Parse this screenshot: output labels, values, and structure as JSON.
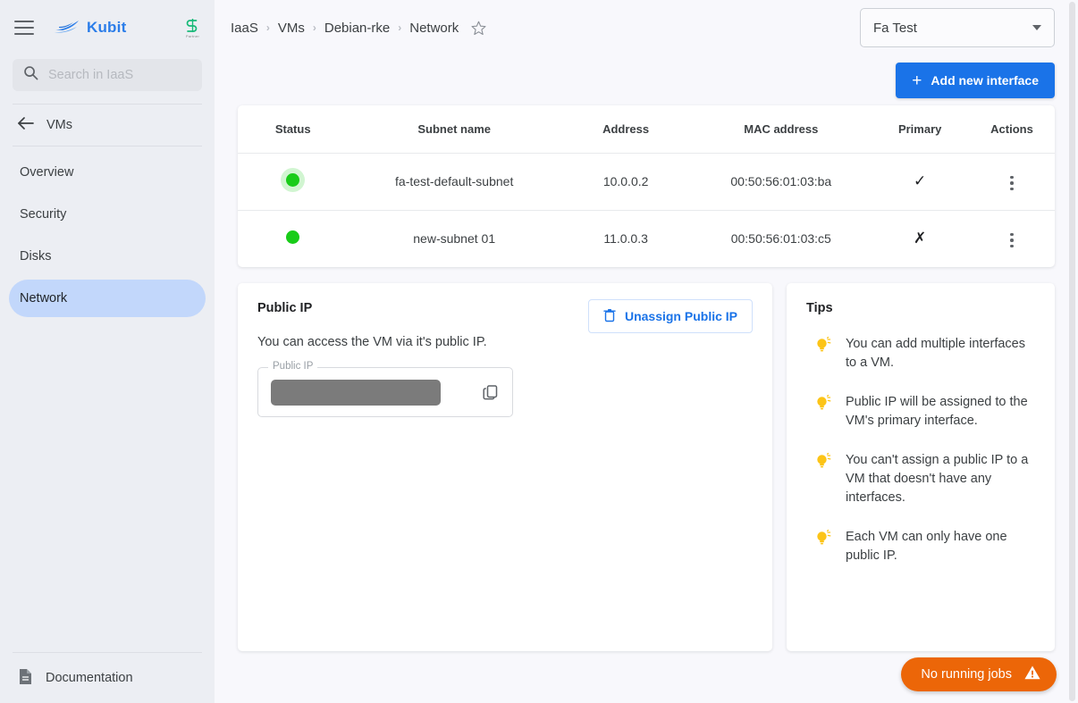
{
  "sidebar": {
    "menu_icon": "hamburger-icon",
    "brand": "Kubit",
    "brand_logo": "boat-logo",
    "partner_logo": "partner-s-logo",
    "partner_sub": "Partner",
    "search": {
      "placeholder": "Search in IaaS",
      "value": ""
    },
    "back": {
      "label": "VMs",
      "icon": "arrow-left-icon"
    },
    "items": [
      {
        "label": "Overview",
        "active": false
      },
      {
        "label": "Security",
        "active": false
      },
      {
        "label": "Disks",
        "active": false
      },
      {
        "label": "Network",
        "active": true
      }
    ],
    "documentation": {
      "label": "Documentation",
      "icon": "document-icon"
    }
  },
  "header": {
    "breadcrumbs": [
      "IaaS",
      "VMs",
      "Debian-rke",
      "Network"
    ],
    "separator": "›",
    "favorite_icon": "star-outline-icon",
    "project_select": {
      "value": "Fa Test",
      "caret": "chevron-down-icon"
    }
  },
  "toolbar": {
    "add_interface_label": "Add new interface",
    "add_interface_icon": "plus-icon"
  },
  "table": {
    "columns": [
      "Status",
      "Subnet name",
      "Address",
      "MAC address",
      "Primary",
      "Actions"
    ],
    "rows": [
      {
        "status": "online",
        "subnet_name": "fa-test-default-subnet",
        "address": "10.0.0.2",
        "mac_address": "00:50:56:01:03:ba",
        "primary": "✓",
        "actions_icon": "kebab-menu-icon"
      },
      {
        "status": "online",
        "subnet_name": "new-subnet 01",
        "address": "11.0.0.3",
        "mac_address": "00:50:56:01:03:c5",
        "primary": "✗",
        "actions_icon": "kebab-menu-icon"
      }
    ]
  },
  "public_ip": {
    "title": "Public IP",
    "description": "You can access the VM via it's public IP.",
    "unassign_label": "Unassign Public IP",
    "unassign_icon": "trash-icon",
    "field_label": "Public IP",
    "field_value": "",
    "field_redacted": true,
    "copy_icon": "copy-icon"
  },
  "tips": {
    "title": "Tips",
    "icon": "lightbulb-icon",
    "items": [
      "You can add multiple interfaces to a VM.",
      "Public IP will be assigned to the VM's primary interface.",
      "You can't assign a public IP to a VM that doesn't have any interfaces.",
      "Each VM can only have one public IP."
    ]
  },
  "jobs_badge": {
    "label": "No running jobs",
    "icon": "warning-triangle-icon"
  },
  "annotation": {
    "type": "arrow",
    "color": "#e01b1b",
    "points_to": "row-2-actions-kebab"
  },
  "colors": {
    "accent": "#1a73e8",
    "sidebar_bg": "#eceef3",
    "page_bg": "#f8f8fc",
    "active_nav": "#c2d7fb",
    "status_online": "#19cc19",
    "badge_orange": "#ec6608",
    "tip_yellow": "#fcc417"
  }
}
